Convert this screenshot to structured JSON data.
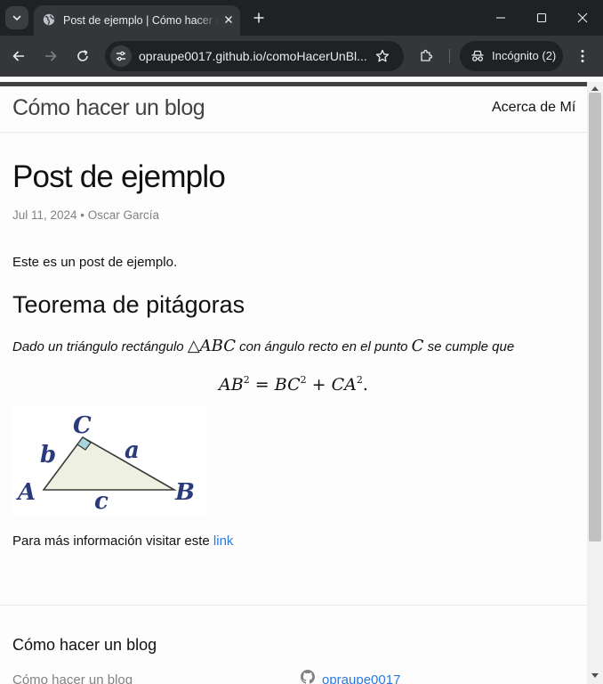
{
  "browser": {
    "tab_title": "Post de ejemplo | Cómo hacer un blog",
    "url": "opraupe0017.github.io/comoHacerUnBl...",
    "incognito_label": "Incógnito (2)",
    "colors": {
      "frame": "#202124",
      "toolbar": "#35363a",
      "text": "#e8eaed"
    }
  },
  "site": {
    "title": "Cómo hacer un blog",
    "nav_link": "Acerca de Mí"
  },
  "post": {
    "title": "Post de ejemplo",
    "meta": "Jul 11, 2024 • Oscar García",
    "intro": "Este es un post de ejemplo.",
    "section_heading": "Teorema de pitágoras",
    "theorem_text_1": "Dado un triángulo rectángulo",
    "theorem_symbol": "△ABC",
    "theorem_text_2": "con ángulo recto en el punto",
    "theorem_point": "C",
    "theorem_text_3": "se cumple que",
    "equation": {
      "lhs": "AB",
      "term1": "BC",
      "term2": "CA",
      "exponent": "2",
      "equals": "=",
      "plus": "+",
      "end": "."
    },
    "figure_labels": {
      "vertex_a": "A",
      "vertex_b": "B",
      "vertex_c": "C",
      "side_a": "a",
      "side_b": "b",
      "side_c": "c"
    },
    "more_info_text": "Para más información visitar este",
    "more_info_link": "link"
  },
  "footer": {
    "title": "Cómo hacer un blog",
    "col1_text": "Cómo hacer un blog",
    "github_user": "opraupe0017"
  },
  "colors": {
    "link": "#2a7ae2",
    "meta": "#828282",
    "header_border": "#424242"
  }
}
